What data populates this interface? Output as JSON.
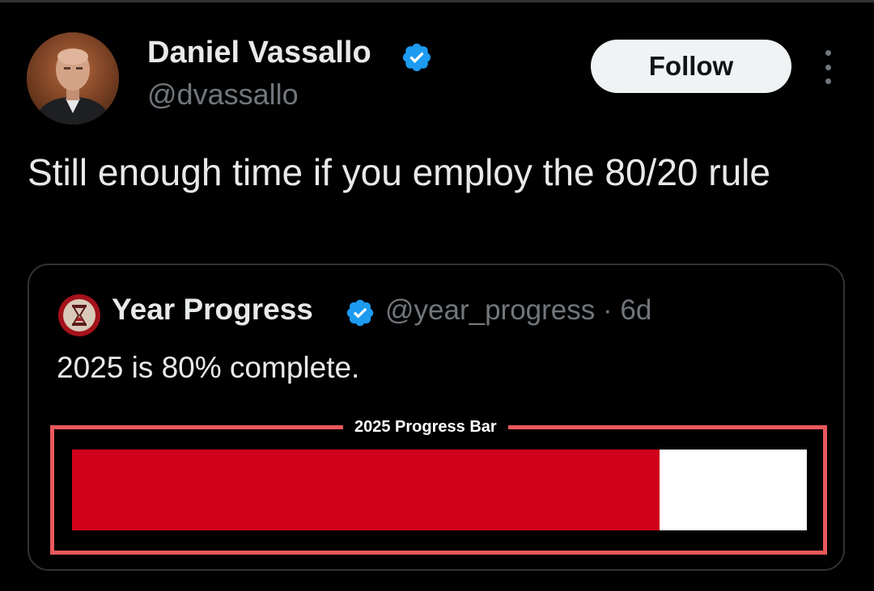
{
  "tweet": {
    "author_name": "Daniel Vassallo",
    "author_handle": "@dvassallo",
    "verified": true,
    "follow_label": "Follow",
    "more_icon": "more-vertical-icon",
    "text": "Still enough time if you employ the 80/20 rule"
  },
  "quote": {
    "author_name": "Year Progress",
    "verified": true,
    "meta": "@year_progress · 6d",
    "text": "2025 is 80% complete.",
    "avatar_icon": "hourglass-icon",
    "progress_bar": {
      "title": "2025 Progress Bar",
      "progress": 0.8,
      "fill_color": "#d0021b",
      "frame_color": "#e9585c",
      "track_color": "#ffffff"
    }
  },
  "colors": {
    "background": "#000000",
    "text_primary": "#e7e9ea",
    "text_secondary": "#71767b",
    "verified_blue": "#1d9bf0",
    "follow_bg": "#eff3f4"
  }
}
